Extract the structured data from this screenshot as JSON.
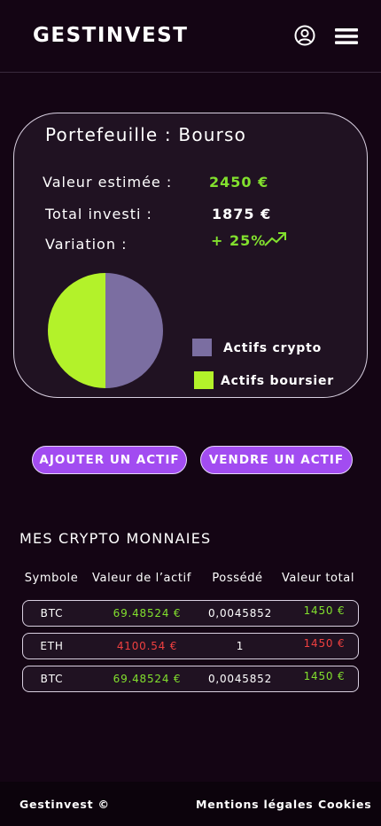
{
  "header": {
    "logo": "GESTINVEST",
    "icons": [
      "user-circle-icon",
      "menu-icon"
    ]
  },
  "portfolio": {
    "title": "Portefeuille : Bourso",
    "estimated_label": "Valeur estimée :",
    "estimated_value": "2450 €",
    "invested_label": "Total investi :",
    "invested_value": "1875 €",
    "variation_label": "Variation :",
    "variation_value": "+ 25%",
    "trend_icon": "trend-up-icon",
    "chart_data": {
      "type": "pie",
      "slices": [
        {
          "label": "Actifs crypto",
          "value": 50,
          "color": "#7b6ea1"
        },
        {
          "label": "Actifs boursier",
          "value": 50,
          "color": "#b3f22a"
        }
      ]
    },
    "legend": [
      "Actifs crypto",
      "Actifs boursier"
    ]
  },
  "actions": {
    "add_label": "AJOUTER UN ACTIF",
    "sell_label": "VENDRE UN ACTIF"
  },
  "crypto": {
    "title": "MES CRYPTO MONNAIES",
    "columns": [
      "Symbole",
      "Valeur de l’actif",
      "Possédé",
      "Valeur total"
    ],
    "rows": [
      {
        "symbol": "BTC",
        "asset_value": "69.48524 €",
        "owned": "0,0045852",
        "total": "1450 €",
        "asset_color": "#82e02e",
        "total_color": "#82e02e"
      },
      {
        "symbol": "ETH",
        "asset_value": "4100.54 €",
        "owned": "1",
        "total": "1450 €",
        "asset_color": "#f04040",
        "total_color": "#f04040"
      },
      {
        "symbol": "BTC",
        "asset_value": "69.48524 €",
        "owned": "0,0045852",
        "total": "1450 €",
        "asset_color": "#82e02e",
        "total_color": "#82e02e"
      }
    ]
  },
  "footer": {
    "brand": "Gestinvest ©",
    "legal": "Mentions légales",
    "cookies": "Cookies"
  }
}
